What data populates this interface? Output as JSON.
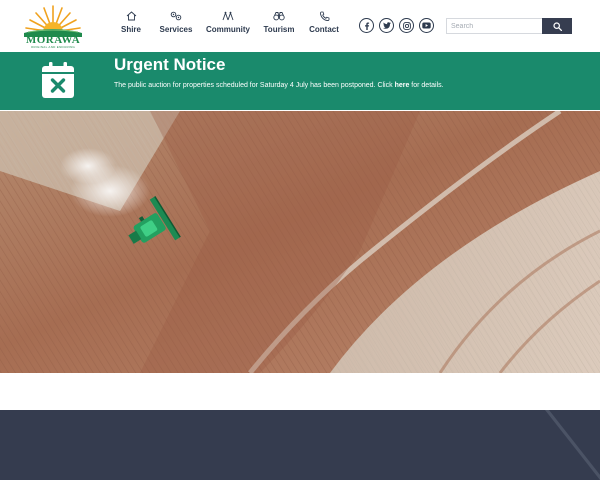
{
  "brand": {
    "name": "MORAWA",
    "tagline": "ORIGINAL AND ENDURING"
  },
  "nav": [
    {
      "label": "Shire",
      "icon": "home-icon"
    },
    {
      "label": "Services",
      "icon": "services-icon"
    },
    {
      "label": "Community",
      "icon": "community-icon"
    },
    {
      "label": "Tourism",
      "icon": "binoculars-icon"
    },
    {
      "label": "Contact",
      "icon": "phone-icon"
    }
  ],
  "socials": [
    "facebook-icon",
    "twitter-icon",
    "instagram-icon",
    "youtube-icon"
  ],
  "search": {
    "placeholder": "Search",
    "button_icon": "search-icon"
  },
  "notice": {
    "title": "Urgent Notice",
    "text_before": "The public auction for properties scheduled for Saturday 4 July has been postponed. Click ",
    "link": "here",
    "text_after": " for details.",
    "icon": "calendar-cancel-icon"
  },
  "hero": {
    "image": "aerial-harvester-field"
  },
  "colors": {
    "notice_green": "#1a8a6c",
    "navy": "#353c4f",
    "nav_text": "#2d3a4e",
    "logo_green": "#1f8a4c",
    "sun_orange": "#f0a21e"
  }
}
